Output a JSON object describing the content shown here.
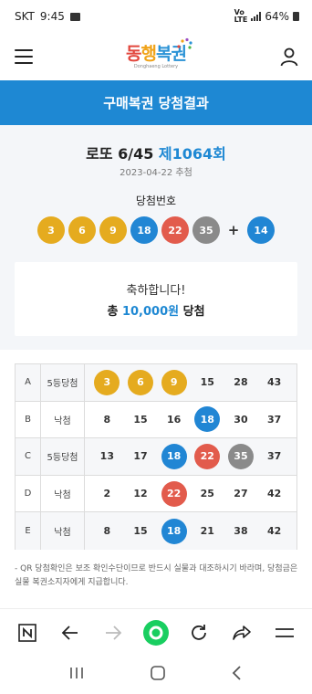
{
  "status": {
    "carrier": "SKT",
    "time": "9:45",
    "battery": "64%"
  },
  "header": {
    "logo_main": [
      "동",
      "행",
      "복권"
    ],
    "logo_sub": "Donghaeng Lottery"
  },
  "banner": {
    "title": "구매복권 당첨결과"
  },
  "draw": {
    "title_prefix": "로또 6/45 ",
    "round": "제1064회",
    "date": "2023-04-22 추첨",
    "win_label": "당첨번호",
    "numbers": [
      {
        "n": "3",
        "color": "yellow"
      },
      {
        "n": "6",
        "color": "yellow"
      },
      {
        "n": "9",
        "color": "yellow"
      },
      {
        "n": "18",
        "color": "blue"
      },
      {
        "n": "22",
        "color": "red"
      },
      {
        "n": "35",
        "color": "gray"
      }
    ],
    "plus": "+",
    "bonus": {
      "n": "14",
      "color": "blue"
    }
  },
  "result": {
    "congrats": "축하합니다!",
    "prize_prefix": "총 ",
    "prize_amount": "10,000원",
    "prize_suffix": " 당첨"
  },
  "ticket": {
    "rows": [
      {
        "line": "A",
        "rank": "5등당첨",
        "nums": [
          [
            "3",
            "y"
          ],
          [
            "6",
            "y"
          ],
          [
            "9",
            "y"
          ],
          [
            "15",
            ""
          ],
          [
            "28",
            ""
          ],
          [
            "43",
            ""
          ]
        ]
      },
      {
        "line": "B",
        "rank": "낙첨",
        "nums": [
          [
            "8",
            ""
          ],
          [
            "15",
            ""
          ],
          [
            "16",
            ""
          ],
          [
            "18",
            "b"
          ],
          [
            "30",
            ""
          ],
          [
            "37",
            ""
          ]
        ]
      },
      {
        "line": "C",
        "rank": "5등당첨",
        "nums": [
          [
            "13",
            ""
          ],
          [
            "17",
            ""
          ],
          [
            "18",
            "b"
          ],
          [
            "22",
            "r"
          ],
          [
            "35",
            "g"
          ],
          [
            "37",
            ""
          ]
        ]
      },
      {
        "line": "D",
        "rank": "낙첨",
        "nums": [
          [
            "2",
            ""
          ],
          [
            "12",
            ""
          ],
          [
            "22",
            "r"
          ],
          [
            "25",
            ""
          ],
          [
            "27",
            ""
          ],
          [
            "42",
            ""
          ]
        ]
      },
      {
        "line": "E",
        "rank": "낙첨",
        "nums": [
          [
            "8",
            ""
          ],
          [
            "15",
            ""
          ],
          [
            "18",
            "b"
          ],
          [
            "21",
            ""
          ],
          [
            "38",
            ""
          ],
          [
            "42",
            ""
          ]
        ]
      }
    ]
  },
  "note": "- QR 당첨확인은 보조 확인수단이므로 반드시 실물과 대조하시기 바라며, 당첨금은 실물 복권소지자에게 지급합니다.",
  "colors": {
    "accent": "#1e88d3",
    "yellow": "#e5ab1f",
    "blue": "#2186d4",
    "red": "#e25b4c",
    "gray": "#8a8a8a",
    "naver_green": "#19ce60"
  },
  "toolbar_icons": [
    "naver-n-icon",
    "back-arrow-icon",
    "forward-arrow-icon",
    "green-dot-icon",
    "refresh-icon",
    "share-icon",
    "menu-lines-icon"
  ],
  "nav_icons": [
    "recent-apps-icon",
    "home-icon",
    "back-icon"
  ]
}
